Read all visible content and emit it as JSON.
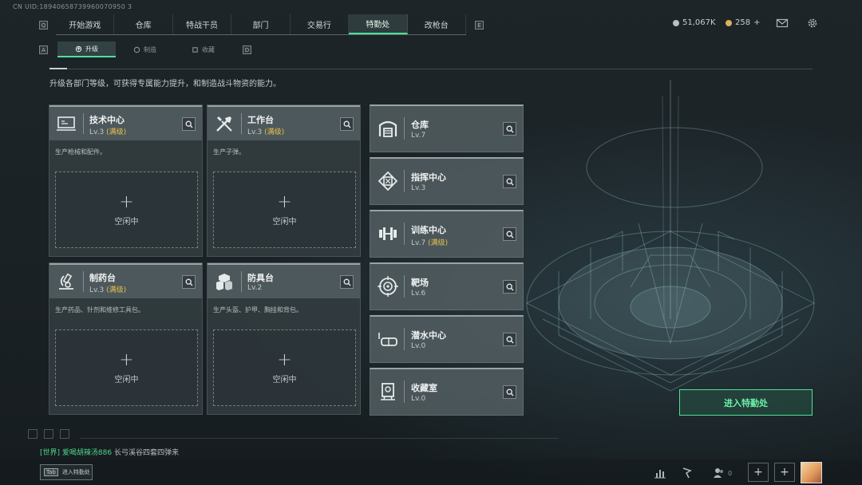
{
  "uid": "CN UID:18940658739960070950 3",
  "topnav": {
    "left_key": "Q",
    "right_key": "E",
    "tabs": [
      {
        "label": "开始游戏",
        "active": false
      },
      {
        "label": "仓库",
        "active": false
      },
      {
        "label": "特战干员",
        "active": false
      },
      {
        "label": "部门",
        "active": false
      },
      {
        "label": "交易行",
        "active": false
      },
      {
        "label": "特勤处",
        "active": true
      },
      {
        "label": "改枪台",
        "active": false
      }
    ]
  },
  "currency": {
    "silver": "51,067K",
    "gold": "258",
    "gold_plus": "+"
  },
  "subnav": {
    "left_key": "A",
    "right_key": "D",
    "tabs": [
      {
        "label": "升级",
        "icon": "upgrade-icon",
        "active": true
      },
      {
        "label": "制造",
        "icon": "craft-icon",
        "active": false
      },
      {
        "label": "收藏",
        "icon": "collection-icon",
        "active": false
      }
    ]
  },
  "description": "升级各部门等级，可获得专属能力提升，和制造战斗物资的能力。",
  "facilities": [
    {
      "name": "技术中心",
      "level": "Lv.3",
      "max": "(满级)",
      "desc": "生产枪械和配件。",
      "slot_plus": "+",
      "slot_status": "空闲中",
      "icon": "tech-center-icon"
    },
    {
      "name": "工作台",
      "level": "Lv.3",
      "max": "(满级)",
      "desc": "生产子弹。",
      "slot_plus": "+",
      "slot_status": "空闲中",
      "icon": "workbench-icon"
    },
    {
      "name": "制药台",
      "level": "Lv.3",
      "max": "(满级)",
      "desc": "生产药品、针剂和维修工具包。",
      "slot_plus": "+",
      "slot_status": "空闲中",
      "icon": "pharmacy-icon"
    },
    {
      "name": "防具台",
      "level": "Lv.2",
      "max": "",
      "desc": "生产头盔、护甲、胸挂和背包。",
      "slot_plus": "+",
      "slot_status": "空闲中",
      "icon": "armor-bench-icon"
    }
  ],
  "departments": [
    {
      "name": "仓库",
      "level": "Lv.7",
      "max": "",
      "icon": "warehouse-icon"
    },
    {
      "name": "指挥中心",
      "level": "Lv.3",
      "max": "",
      "icon": "command-center-icon"
    },
    {
      "name": "训练中心",
      "level": "Lv.7",
      "max": "(满级)",
      "icon": "training-center-icon"
    },
    {
      "name": "靶场",
      "level": "Lv.6",
      "max": "",
      "icon": "shooting-range-icon"
    },
    {
      "name": "潜水中心",
      "level": "Lv.0",
      "max": "",
      "icon": "diving-center-icon"
    },
    {
      "name": "收藏室",
      "level": "Lv.0",
      "max": "",
      "icon": "collection-room-icon"
    }
  ],
  "enter_button": "进入特勤处",
  "chat": {
    "channel": "[世界]",
    "user": "爱喝胡辣汤886",
    "message": "长弓溪谷四套四弹来"
  },
  "tab_hint": {
    "key": "Tab",
    "label": "进入特勤处"
  },
  "bottom": {
    "friends_count": "0",
    "plus1": "+",
    "plus2": "+"
  },
  "colors": {
    "accent": "#4fe09a",
    "max_level": "#e6c14c"
  }
}
